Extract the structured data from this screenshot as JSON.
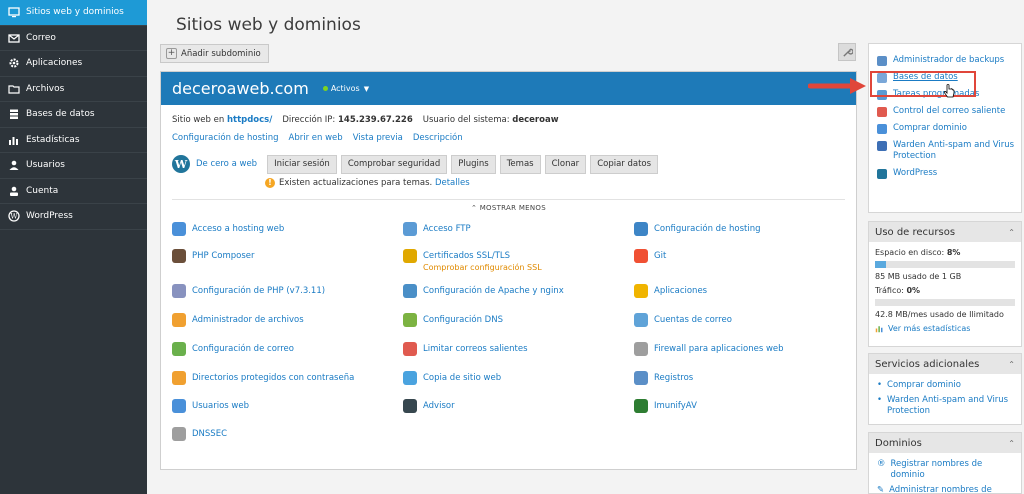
{
  "sidebar": {
    "items": [
      {
        "label": "Sitios web y dominios",
        "icon": "monitor-icon",
        "active": true
      },
      {
        "label": "Correo",
        "icon": "envelope-icon"
      },
      {
        "label": "Aplicaciones",
        "icon": "gear-icon"
      },
      {
        "label": "Archivos",
        "icon": "folder-icon"
      },
      {
        "label": "Bases de datos",
        "icon": "database-icon"
      },
      {
        "label": "Estadísticas",
        "icon": "bar-chart-icon"
      },
      {
        "label": "Usuarios",
        "icon": "user-icon"
      },
      {
        "label": "Cuenta",
        "icon": "account-icon"
      },
      {
        "label": "WordPress",
        "icon": "wordpress-icon"
      }
    ]
  },
  "main": {
    "title": "Sitios web y dominios",
    "add_subdomain": "Añadir subdominio",
    "domain": {
      "name": "deceroaweb.com",
      "status": "Activos",
      "site_label": "Sitio web en",
      "site_path": "httpdocs/",
      "ip_label": "Dirección IP:",
      "ip": "145.239.67.226",
      "user_label": "Usuario del sistema:",
      "user": "deceroaw",
      "links": [
        "Configuración de hosting",
        "Abrir en web",
        "Vista previa",
        "Descripción"
      ],
      "wp": {
        "name": "De cero a web",
        "buttons": [
          "Iniciar sesión",
          "Comprobar seguridad",
          "Plugins",
          "Temas",
          "Clonar",
          "Copiar datos"
        ],
        "update_note": "Existen actualizaciones para temas.",
        "update_link": "Detalles"
      },
      "show_less": "MOSTRAR MENOS",
      "tools": [
        {
          "label": "Acceso a hosting web",
          "color": "#4a90d9"
        },
        {
          "label": "Acceso FTP",
          "color": "#5b9bd5"
        },
        {
          "label": "Configuración de hosting",
          "color": "#3d85c6"
        },
        {
          "label": "PHP Composer",
          "color": "#6b4f3a"
        },
        {
          "label": "Certificados SSL/TLS",
          "sub": "Comprobar configuración SSL",
          "color": "#e0a800"
        },
        {
          "label": "Git",
          "color": "#f05033"
        },
        {
          "label": "Configuración de PHP (v7.3.11)",
          "color": "#8892bf"
        },
        {
          "label": "Configuración de Apache y nginx",
          "color": "#4a8fc7"
        },
        {
          "label": "Aplicaciones",
          "color": "#f0b400"
        },
        {
          "label": "Administrador de archivos",
          "color": "#f0a030"
        },
        {
          "label": "Configuración DNS",
          "color": "#7cb342"
        },
        {
          "label": "Cuentas de correo",
          "color": "#5fa3d8"
        },
        {
          "label": "Configuración de correo",
          "color": "#6ab04c"
        },
        {
          "label": "Limitar correos salientes",
          "color": "#e05a4f"
        },
        {
          "label": "Firewall para aplicaciones web",
          "color": "#9e9e9e"
        },
        {
          "label": "Directorios protegidos con contraseña",
          "color": "#f0a030"
        },
        {
          "label": "Copia de sitio web",
          "color": "#4aa3df"
        },
        {
          "label": "Registros",
          "color": "#5b8fc7"
        },
        {
          "label": "Usuarios web",
          "color": "#4a90d9"
        },
        {
          "label": "Advisor",
          "color": "#37474f"
        },
        {
          "label": "ImunifyAV",
          "color": "#2e7d32"
        },
        {
          "label": "DNSSEC",
          "color": "#9e9e9e"
        }
      ]
    }
  },
  "right": {
    "services": [
      {
        "label": "Administrador de backups",
        "color": "#5b8fc7"
      },
      {
        "label": "Bases de datos",
        "color": "#7aa7d8"
      },
      {
        "label": "Tareas programadas",
        "color": "#5b9bd5"
      },
      {
        "label": "Control del correo saliente",
        "color": "#e05a4f"
      },
      {
        "label": "Comprar dominio",
        "color": "#4a90d9"
      },
      {
        "label": "Warden Anti-spam and Virus Protection",
        "color": "#3d6fb5"
      },
      {
        "label": "WordPress",
        "color": "#21759b"
      }
    ],
    "resources": {
      "title": "Uso de recursos",
      "disk_label": "Espacio en disco:",
      "disk_value": "8%",
      "disk_fraction": 0.08,
      "disk_usage": "85 MB usado de 1 GB",
      "traffic_label": "Tráfico:",
      "traffic_value": "0%",
      "traffic_fraction": 0.0,
      "traffic_usage": "42.8 MB/mes usado de Ilimitado",
      "more_stats": "Ver más estadísticas"
    },
    "extra": {
      "title": "Servicios adicionales",
      "items": [
        "Comprar dominio",
        "Warden Anti-spam and Virus Protection"
      ]
    },
    "domains": {
      "title": "Dominios",
      "items": [
        "Registrar nombres de dominio",
        "Administrar nombres de dominio"
      ]
    }
  },
  "colors": {
    "sidebar_bg": "#2d343a",
    "active_nav": "#1e9ad6",
    "domain_header": "#1e7ab8",
    "link": "#1a7bc4",
    "highlight": "#e0463a"
  }
}
